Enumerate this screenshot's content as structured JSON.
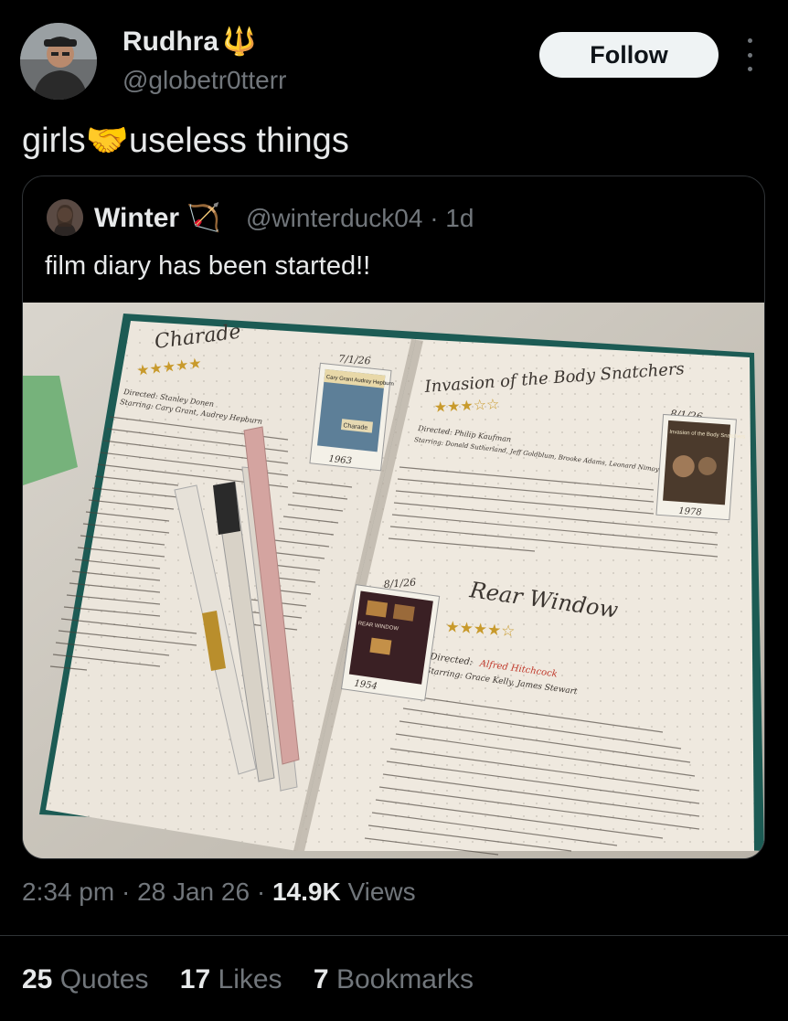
{
  "author": {
    "display_name": "Rudhra",
    "name_emoji": "🔱",
    "handle": "@globetr0tterr"
  },
  "follow_label": "Follow",
  "tweet": {
    "text_before": "girls",
    "emoji": "🤝",
    "text_after": "useless things"
  },
  "quoted": {
    "display_name": "Winter",
    "name_emoji": "🏹",
    "handle": "@winterduck04",
    "separator": "·",
    "age": "1d",
    "text": "film diary has been started!!",
    "image": {
      "left_page": {
        "title": "Charade",
        "date": "7/1/26",
        "year": "1963",
        "directed": "Directed: Stanley Donen",
        "starring": "Starring: Cary Grant, Audrey Hepburn",
        "poster_names": "Cary Grant  Audrey Hepburn",
        "poster_title": "Charade",
        "stars": "★★★★★"
      },
      "right_page_top": {
        "title": "Invasion of the Body Snatchers",
        "date": "8/1/26",
        "year": "1978",
        "directed": "Directed: Philip Kaufman",
        "starring": "Starring: Donald Sutherland, Jeff Goldblum, Brooke Adams, Leonard Nimoy",
        "poster_title": "Invasion of the Body Snatchers",
        "stars": "★★★☆☆"
      },
      "right_page_bottom": {
        "title": "Rear Window",
        "date": "8/1/26",
        "year": "1954",
        "directed_label": "Directed:",
        "director": "Alfred Hitchcock",
        "starring": "Starring: Grace Kelly, James Stewart",
        "poster_title": "REAR WINDOW",
        "stars": "★★★★☆"
      }
    }
  },
  "meta": {
    "time": "2:34 pm",
    "dot": "·",
    "date": "28 Jan 26",
    "views_count": "14.9K",
    "views_label": "Views"
  },
  "stats": {
    "quotes_count": "25",
    "quotes_label": "Quotes",
    "likes_count": "17",
    "likes_label": "Likes",
    "bookmarks_count": "7",
    "bookmarks_label": "Bookmarks"
  },
  "colors": {
    "background": "#000000",
    "text_primary": "#e7e9ea",
    "text_secondary": "#71767b",
    "border": "#2f3336",
    "follow_bg": "#eff3f4"
  }
}
